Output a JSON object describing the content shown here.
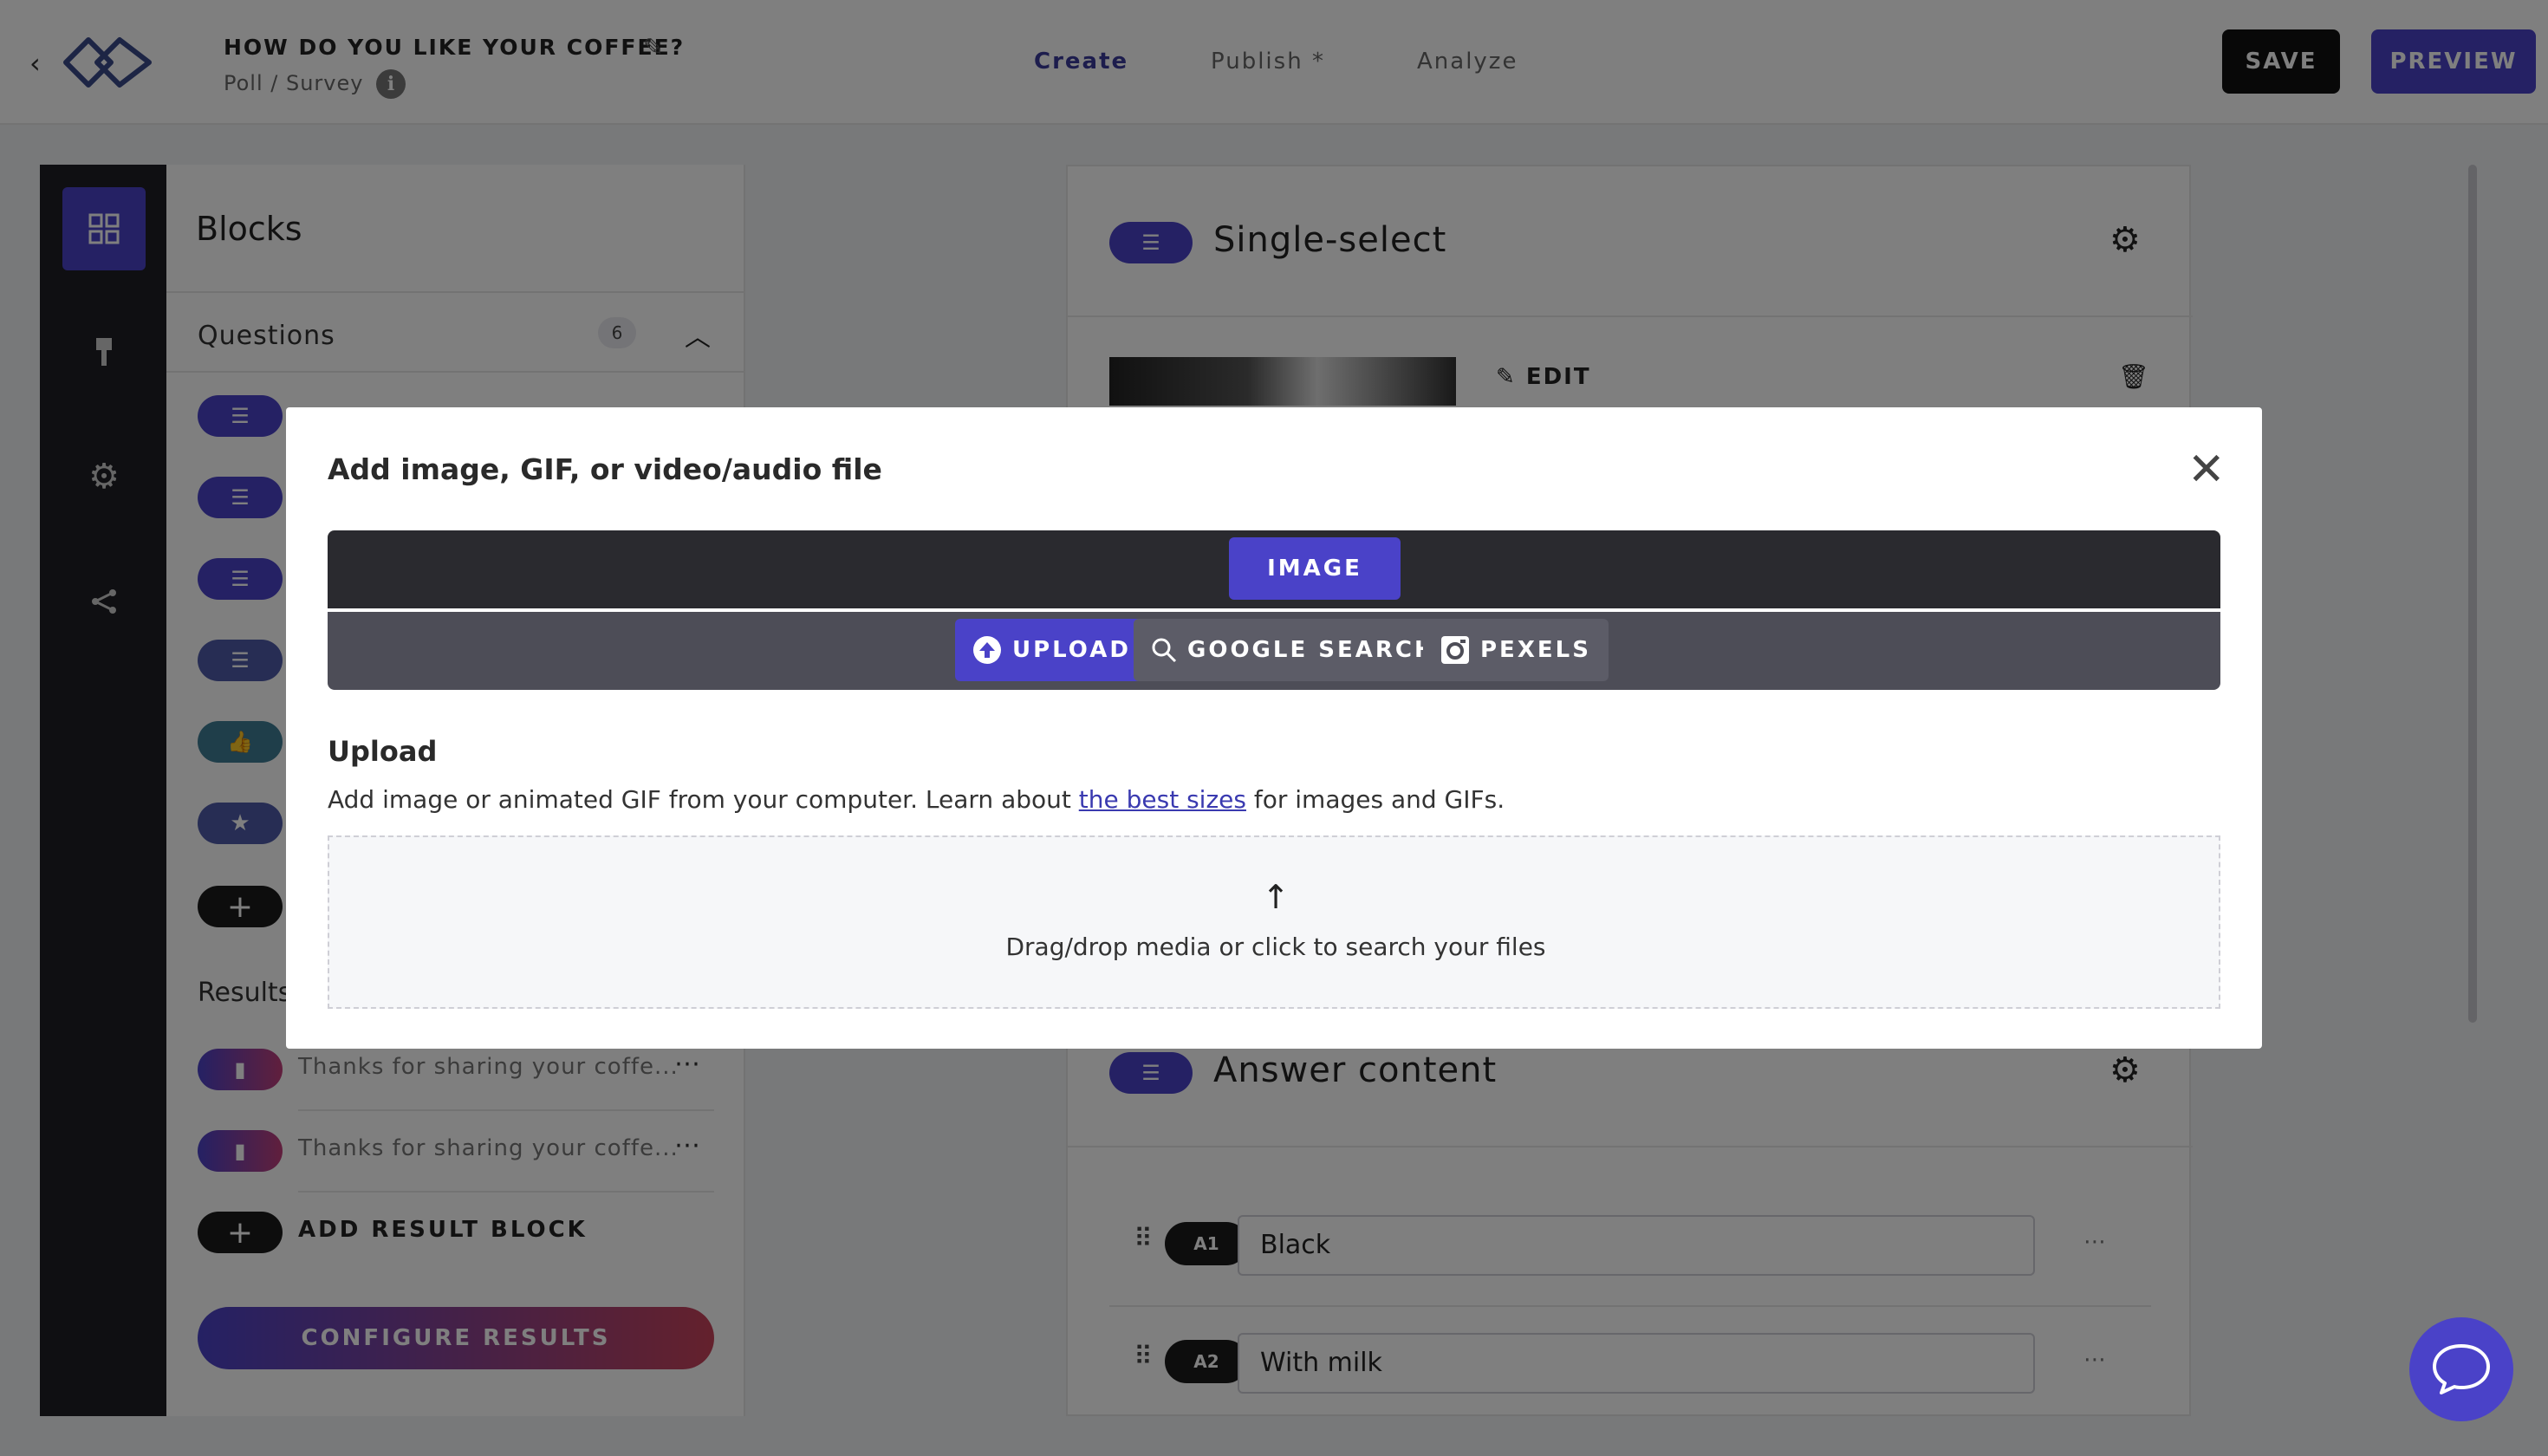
{
  "header": {
    "title": "HOW DO YOU LIKE YOUR COFFEE?",
    "type": "Poll / Survey",
    "info_icon": "i",
    "tabs": [
      "Create",
      "Publish *",
      "Analyze"
    ],
    "save_label": "SAVE",
    "preview_label": "PREVIEW"
  },
  "sidebar": {
    "title": "Blocks",
    "questions_label": "Questions",
    "questions_count": "6",
    "results_label": "Results",
    "results": [
      "Thanks for sharing your coffe...",
      "Thanks for sharing your coffe..."
    ],
    "add_result_label": "ADD RESULT BLOCK",
    "configure_label": "CONFIGURE RESULTS",
    "plus_glyph": "+",
    "more_glyph": "⋯"
  },
  "editor": {
    "block_title": "Single-select",
    "edit_label": "EDIT",
    "answers_title": "Answer content",
    "answers": [
      {
        "tag": "A1",
        "value": "Black"
      },
      {
        "tag": "A2",
        "value": "With milk"
      }
    ]
  },
  "modal": {
    "title": "Add image, GIF, or video/audio file",
    "main_tab": "IMAGE",
    "subtabs": [
      "UPLOAD",
      "GOOGLE SEARCH",
      "PEXELS"
    ],
    "section_title": "Upload",
    "desc_before": "Add image or animated GIF from your computer. Learn about ",
    "desc_link": "the best sizes",
    "desc_after": " for images and GIFs.",
    "drop_text": "Drag/drop media or click to search your files"
  },
  "colors": {
    "accent": "#4a42c8",
    "dark": "#1f1f24",
    "teal": "#3f7d94"
  },
  "icons": [
    "chevron-left-icon",
    "logo-icon",
    "pencil-icon",
    "info-icon",
    "grid-icon",
    "brush-icon",
    "gear-icon",
    "share-icon",
    "list-icon",
    "thumbs-up-icon",
    "star-icon",
    "bookmark-icon",
    "plus-icon",
    "trash-icon",
    "close-icon",
    "upload-icon",
    "search-icon",
    "camera-icon",
    "arrow-up-icon",
    "chat-icon"
  ]
}
